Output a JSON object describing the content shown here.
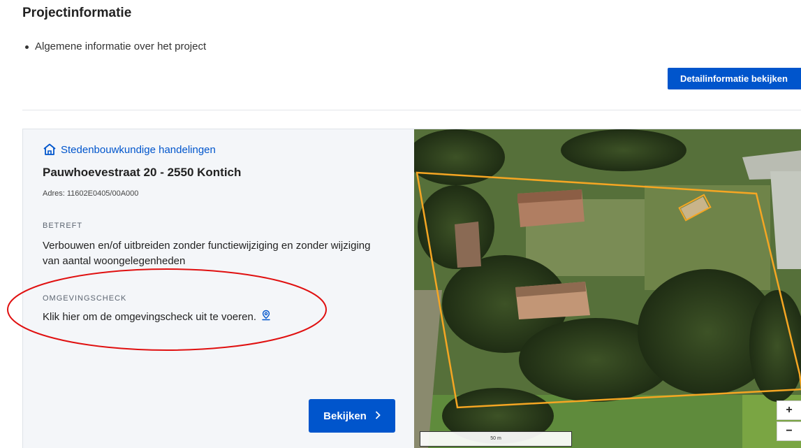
{
  "section": {
    "title": "Projectinformatie",
    "bullets": [
      "Algemene informatie over het project"
    ],
    "detail_button": "Detailinformatie bekijken"
  },
  "card": {
    "procedure_link": "Stedenbouwkundige handelingen",
    "address": "Pauwhoevestraat 20 - 2550 Kontich",
    "adres_code": "Adres: 11602E0405/00A000",
    "betreft_label": "BETREFT",
    "betreft_text": "Verbouwen en/of uitbreiden zonder functiewijziging en zonder wijziging van aantal woongelegenheden",
    "omgevingscheck_label": "OMGEVINGSCHECK",
    "omgevingscheck_text": "Klik hier om de omgevingscheck uit te voeren.",
    "view_button": "Bekijken"
  },
  "map": {
    "zoom_in": "+",
    "zoom_out": "−",
    "scale": "50 m",
    "parcel_color": "#f5a623",
    "annotation_color": "#e01010"
  },
  "colors": {
    "accent": "#0055cc"
  }
}
